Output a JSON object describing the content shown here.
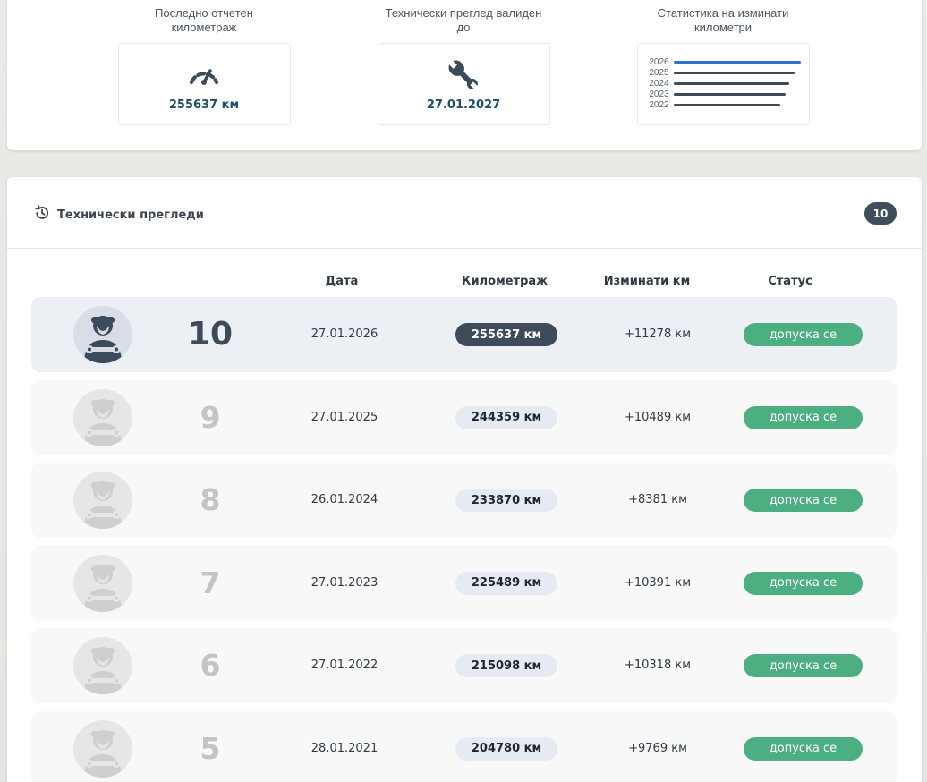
{
  "stats": {
    "mileage": {
      "title_line1": "Последно отчетен",
      "title_line2": "километраж",
      "value": "255637 км",
      "icon": "speedometer-icon"
    },
    "inspection": {
      "title_line1": "Технически преглед валиден",
      "title_line2": "до",
      "value": "27.01.2027",
      "icon": "wrench-icon"
    },
    "statistics": {
      "title_line1": "Статистика на изминати",
      "title_line2": "километри",
      "years": [
        {
          "year": "2026",
          "level": 1.0,
          "highlight": true
        },
        {
          "year": "2025",
          "level": 0.95,
          "highlight": false
        },
        {
          "year": "2024",
          "level": 0.91,
          "highlight": false
        },
        {
          "year": "2023",
          "level": 0.88,
          "highlight": false
        },
        {
          "year": "2022",
          "level": 0.84,
          "highlight": false
        }
      ],
      "colors": {
        "highlight": "#2e6fd4",
        "normal": "#3c4a59"
      }
    }
  },
  "inspections": {
    "title": "Технически прегледи",
    "icon": "history-icon",
    "count": "10",
    "columns": {
      "date": "Дата",
      "mileage": "Километраж",
      "traveled": "Изминати км",
      "status": "Статус"
    },
    "rows": [
      {
        "number": "10",
        "date": "27.01.2026",
        "mileage": "255637 км",
        "traveled": "+11278 км",
        "status": "допуска се",
        "active": true
      },
      {
        "number": "9",
        "date": "27.01.2025",
        "mileage": "244359 км",
        "traveled": "+10489 км",
        "status": "допуска се",
        "active": false
      },
      {
        "number": "8",
        "date": "26.01.2024",
        "mileage": "233870 км",
        "traveled": "+8381 км",
        "status": "допуска се",
        "active": false
      },
      {
        "number": "7",
        "date": "27.01.2023",
        "mileage": "225489 км",
        "traveled": "+10391 км",
        "status": "допуска се",
        "active": false
      },
      {
        "number": "6",
        "date": "27.01.2022",
        "mileage": "215098 км",
        "traveled": "+10318 км",
        "status": "допуска се",
        "active": false
      },
      {
        "number": "5",
        "date": "28.01.2021",
        "mileage": "204780 км",
        "traveled": "+9769 км",
        "status": "допуска се",
        "active": false
      }
    ]
  },
  "colors": {
    "status_green": "#4caf82",
    "dark_slate": "#3c4a59",
    "accent_blue": "#2e6fd4"
  }
}
